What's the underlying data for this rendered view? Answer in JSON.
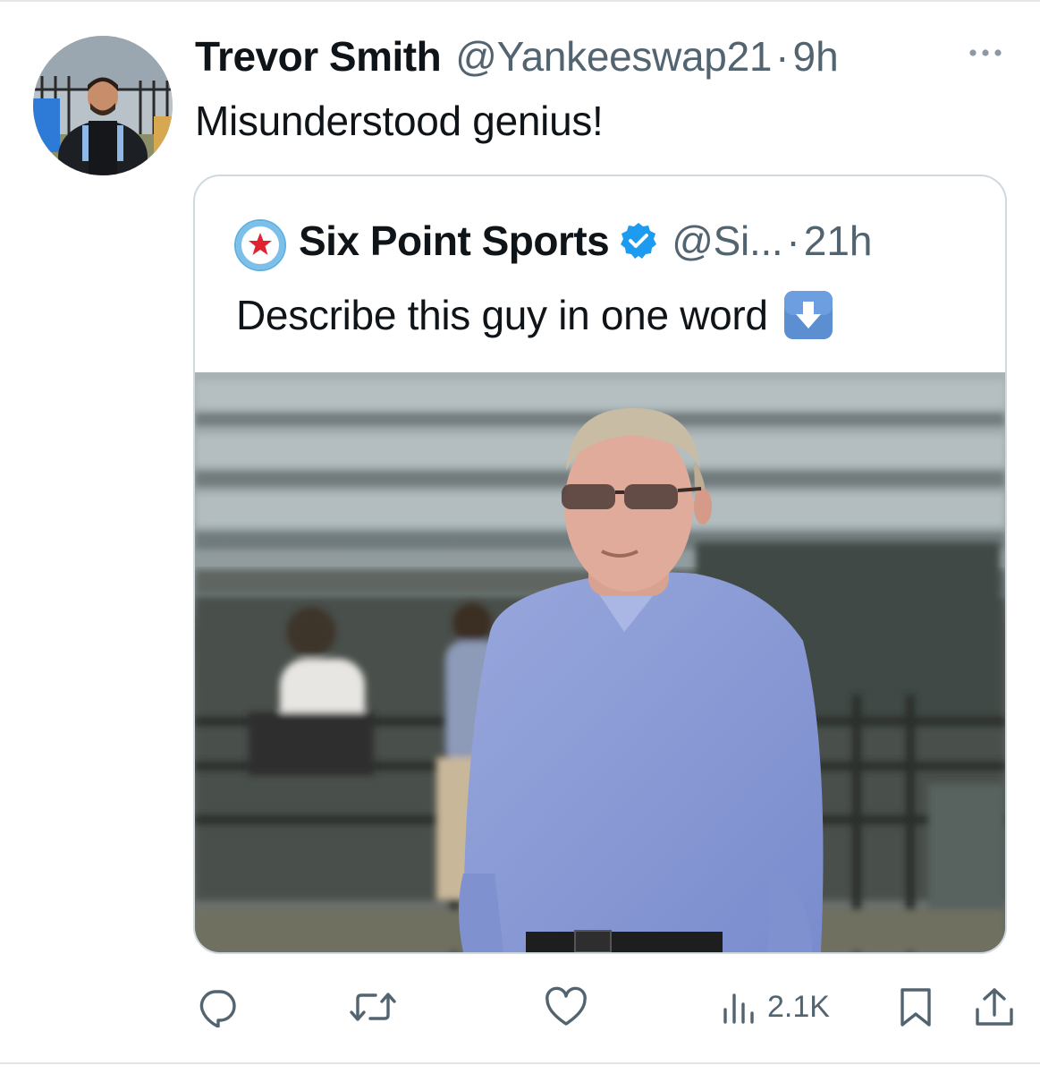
{
  "tweet": {
    "author_name": "Trevor Smith",
    "author_handle": "@Yankeeswap21",
    "separator": "·",
    "time": "9h",
    "text": "Misunderstood genius!"
  },
  "quoted": {
    "author_name": "Six Point Sports",
    "verified": true,
    "author_handle": "@Si...",
    "separator": "·",
    "time": "21h",
    "text": "Describe this guy in one word",
    "emoji": "down-arrow-emoji"
  },
  "actions": {
    "reply_icon": "reply-icon",
    "retweet_icon": "retweet-icon",
    "like_icon": "heart-icon",
    "views_icon": "views-bar-chart-icon",
    "views_count": "2.1K",
    "bookmark_icon": "bookmark-icon",
    "share_icon": "share-icon"
  },
  "colors": {
    "text_primary": "#0f1419",
    "text_secondary": "#536471",
    "verified_blue": "#1d9bf0",
    "border": "#cfd9de"
  }
}
